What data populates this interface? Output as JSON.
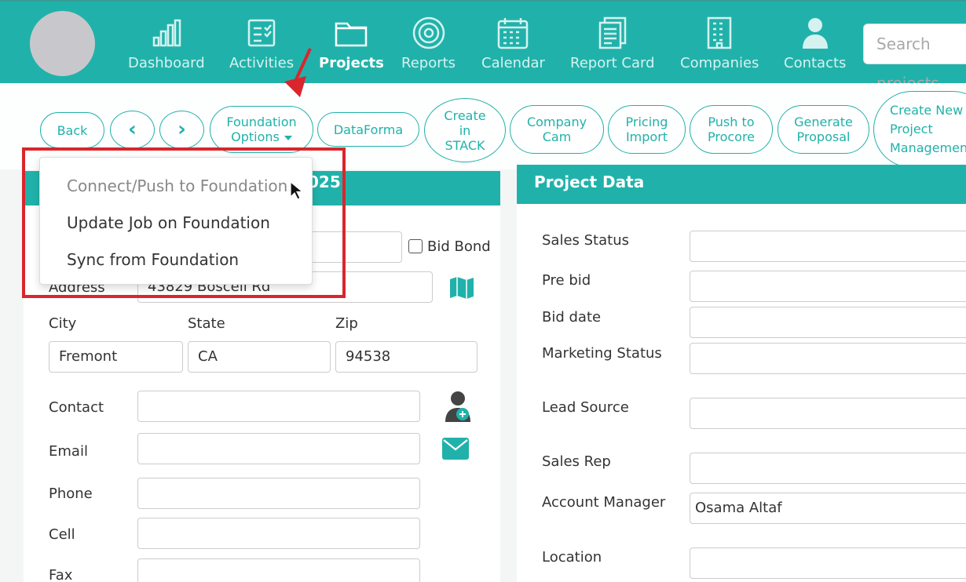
{
  "nav": {
    "items": [
      {
        "label": "Dashboard",
        "icon": "bar-chart-icon"
      },
      {
        "label": "Activities",
        "icon": "checklist-icon"
      },
      {
        "label": "Projects",
        "icon": "folder-icon"
      },
      {
        "label": "Reports",
        "icon": "target-icon"
      },
      {
        "label": "Calendar",
        "icon": "calendar-icon"
      },
      {
        "label": "Report Card",
        "icon": "report-card-icon"
      },
      {
        "label": "Companies",
        "icon": "building-icon"
      },
      {
        "label": "Contacts",
        "icon": "person-icon"
      }
    ],
    "active": "Projects",
    "search_placeholder": "Search projects"
  },
  "toolbar": {
    "back": "Back",
    "prev": "‹",
    "next": "›",
    "foundation_options": "Foundation Options",
    "dataforma": "DataForma",
    "create_in_stack": "Create in STACK",
    "company_cam": "Company Cam",
    "pricing_import": "Pricing Import",
    "push_to_procore": "Push to Procore",
    "generate_proposal": "Generate Proposal",
    "create_new_pm": "Create New Project Management"
  },
  "dropdown": {
    "items": [
      "Connect/Push to Foundation",
      "Update Job on Foundation",
      "Sync from Foundation"
    ]
  },
  "left_panel": {
    "header_suffix": "025",
    "bid_bond": "Bid Bond",
    "address_label": "Address",
    "address_value": "43829 Boscell Rd",
    "city_label": "City",
    "state_label": "State",
    "zip_label": "Zip",
    "city_value": "Fremont",
    "state_value": "CA",
    "zip_value": "94538",
    "contact_label": "Contact",
    "email_label": "Email",
    "phone_label": "Phone",
    "cell_label": "Cell",
    "fax_label": "Fax"
  },
  "right_panel": {
    "header": "Project Data",
    "sales_status": "Sales Status",
    "pre_bid": "Pre bid",
    "bid_date": "Bid date",
    "marketing_status": "Marketing Status",
    "lead_source": "Lead Source",
    "sales_rep": "Sales Rep",
    "account_manager": "Account Manager",
    "account_manager_value": "Osama Altaf",
    "location": "Location"
  },
  "colors": {
    "accent": "#20b2aa",
    "highlight": "#d9262c"
  }
}
